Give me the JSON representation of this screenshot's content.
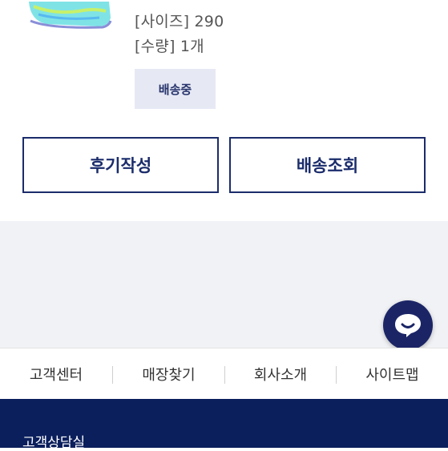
{
  "order_item": {
    "size_line": "[사이즈] 290",
    "quantity_line": "[수량] 1개",
    "status_badge": "배송중"
  },
  "actions": {
    "review_label": "후기작성",
    "track_label": "배송조회"
  },
  "chat": {
    "icon": "chat-bubble-smile-icon"
  },
  "footer_nav": {
    "items": [
      {
        "label": "고객센터"
      },
      {
        "label": "매장찾기"
      },
      {
        "label": "회사소개"
      },
      {
        "label": "사이트맵"
      }
    ]
  },
  "footer": {
    "title": "고객상담실"
  },
  "colors": {
    "navy": "#1b2c6b",
    "footer_bg": "#0b1f5c",
    "badge_bg": "#e6e9f4",
    "gray_bg": "#f1f2f5"
  }
}
